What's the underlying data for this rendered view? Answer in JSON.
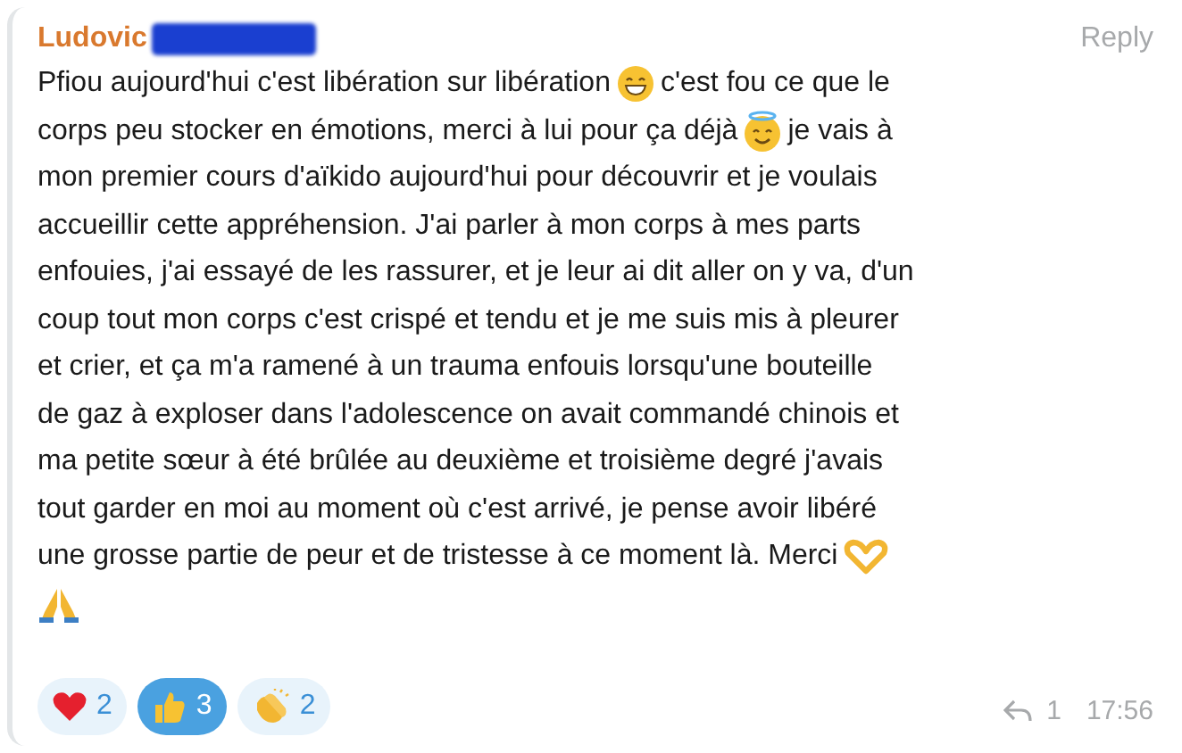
{
  "message": {
    "author": "Ludovic",
    "reply_label": "Reply",
    "lines": [
      [
        {
          "kind": "text",
          "text": "Pfiou aujourd'hui c'est libération sur libération"
        },
        {
          "kind": "grin"
        },
        {
          "kind": "text",
          "text": "c'est fou ce que le"
        }
      ],
      [
        {
          "kind": "text",
          "text": "corps peu stocker en émotions, merci à lui pour ça déjà"
        },
        {
          "kind": "halo"
        },
        {
          "kind": "text",
          "text": "je vais à"
        }
      ],
      [
        {
          "kind": "text",
          "text": "mon premier cours d'aïkido aujourd'hui pour découvrir et je voulais"
        }
      ],
      [
        {
          "kind": "text",
          "text": "accueillir cette appréhension. J'ai parler à mon corps à mes parts"
        }
      ],
      [
        {
          "kind": "text",
          "text": "enfouies, j'ai essayé de les rassurer, et je leur ai dit aller on y va, d'un"
        }
      ],
      [
        {
          "kind": "text",
          "text": "coup tout mon corps c'est crispé et tendu et je me suis mis à pleurer"
        }
      ],
      [
        {
          "kind": "text",
          "text": "et crier, et ça m'a ramené à un trauma enfouis lorsqu'une bouteille"
        }
      ],
      [
        {
          "kind": "text",
          "text": "de gaz à exploser dans l'adolescence on avait commandé chinois et"
        }
      ],
      [
        {
          "kind": "text",
          "text": "ma petite sœur à été brûlée au deuxième et troisième degré j'avais"
        }
      ],
      [
        {
          "kind": "text",
          "text": "tout garder en moi au moment où c'est arrivé, je pense avoir libéré"
        }
      ],
      [
        {
          "kind": "text",
          "text": "une grosse partie de peur et de tristesse à ce moment là. Merci"
        },
        {
          "kind": "hearthands"
        }
      ],
      [
        {
          "kind": "pray"
        }
      ]
    ],
    "reactions": [
      {
        "kind": "heart",
        "count": "2",
        "selected": false
      },
      {
        "kind": "thumbs",
        "count": "3",
        "selected": true
      },
      {
        "kind": "clap",
        "count": "2",
        "selected": false
      }
    ],
    "replies": "1",
    "time": "17:56"
  }
}
